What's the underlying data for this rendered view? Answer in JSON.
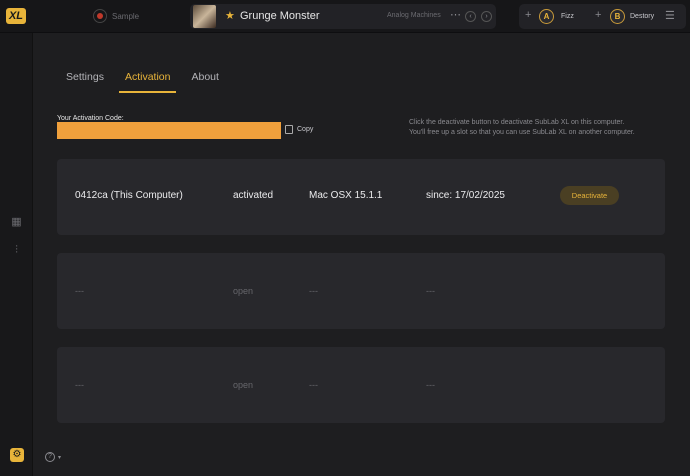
{
  "topbar": {
    "logo": "XL",
    "record_label": "Sample",
    "preset_name": "Grunge Monster",
    "preset_category": "Analog Machines",
    "macros": [
      {
        "letter": "A",
        "label": "Fizz"
      },
      {
        "letter": "B",
        "label": "Destory"
      }
    ]
  },
  "tabs": [
    {
      "label": "Settings",
      "active": false
    },
    {
      "label": "Activation",
      "active": true
    },
    {
      "label": "About",
      "active": false
    }
  ],
  "activation": {
    "code_label": "Your Activation Code:",
    "code_value": "",
    "copy_label": "Copy",
    "info_line1": "Click the deactivate button to deactivate SubLab XL on this computer.",
    "info_line2": "You'll free up a slot so that you can use SubLab XL on another computer."
  },
  "slots": [
    {
      "device": "0412ca (This Computer)",
      "status": "activated",
      "os": "Mac OSX 15.1.1",
      "since": "since: 17/02/2025",
      "button": "Deactivate"
    },
    {
      "device": "---",
      "status": "open",
      "os": "---",
      "since": "---"
    },
    {
      "device": "---",
      "status": "open",
      "os": "---",
      "since": "---"
    }
  ],
  "icons": {
    "record": "record-icon",
    "star": "star-icon",
    "more": "more-icon",
    "grid": "grid-icon",
    "sliders": "sliders-icon",
    "settings": "settings-icon",
    "help": "help-icon"
  },
  "colors": {
    "accent": "#e8b43a",
    "code_field": "#f0a03c",
    "row_bg": "#28282c"
  }
}
